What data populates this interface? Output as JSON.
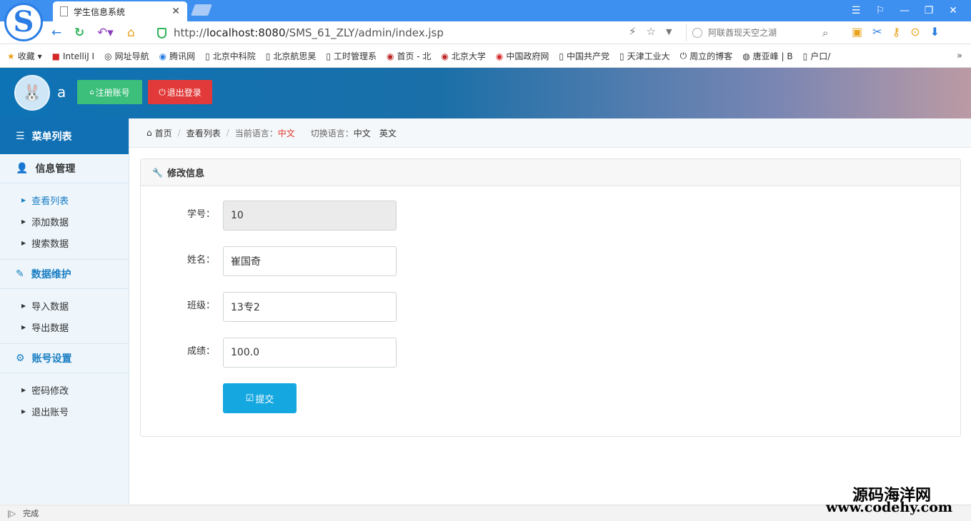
{
  "browser": {
    "tab_title": "学生信息系统",
    "url_prefix": "http://",
    "url_host": "localhost:8080",
    "url_path": "/SMS_61_ZLY/admin/index.jsp",
    "search_placeholder": "阿联酋现天空之湖",
    "window_controls": [
      "☰",
      "⚐",
      "—",
      "❐",
      "✕"
    ]
  },
  "bookmarks": [
    {
      "icon": "★",
      "label": "收藏 ▾"
    },
    {
      "icon": "■",
      "label": "IntelliJ I"
    },
    {
      "icon": "◎",
      "label": "网址导航"
    },
    {
      "icon": "◉",
      "label": "腾讯网"
    },
    {
      "icon": "▯",
      "label": "北京中科院"
    },
    {
      "icon": "▯",
      "label": "北京航思昊"
    },
    {
      "icon": "▯",
      "label": "工时管理系"
    },
    {
      "icon": "◉",
      "label": "首页 - 北"
    },
    {
      "icon": "◉",
      "label": "北京大学"
    },
    {
      "icon": "◉",
      "label": "中国政府网"
    },
    {
      "icon": "▯",
      "label": "中国共产党"
    },
    {
      "icon": "▯",
      "label": "天津工业大"
    },
    {
      "icon": "⏻",
      "label": "周立的博客"
    },
    {
      "icon": "◍",
      "label": "唐亚峰 | B"
    },
    {
      "icon": "▯",
      "label": "户口/"
    }
  ],
  "header": {
    "username": "a",
    "register_label": "注册账号",
    "logout_label": "退出登录"
  },
  "sidebar": {
    "title": "菜单列表",
    "groups": [
      {
        "title": "信息管理",
        "items": [
          "查看列表",
          "添加数据",
          "搜索数据"
        ]
      },
      {
        "title": "数据维护",
        "items": [
          "导入数据",
          "导出数据"
        ]
      },
      {
        "title": "账号设置",
        "items": [
          "密码修改",
          "退出账号"
        ]
      }
    ]
  },
  "breadcrumb": {
    "home": "首页",
    "current": "查看列表",
    "lang_label": "当前语言：",
    "lang_value": "中文",
    "switch_label": "切换语言：",
    "switch_zh": "中文",
    "switch_en": "英文"
  },
  "form": {
    "title": "修改信息",
    "fields": [
      {
        "label": "学号：",
        "value": "10"
      },
      {
        "label": "姓名：",
        "value": "崔国奇"
      },
      {
        "label": "班级：",
        "value": "13专2"
      },
      {
        "label": "成绩：",
        "value": "100.0"
      }
    ],
    "submit_label": "提交"
  },
  "status": {
    "text": "完成"
  },
  "watermark": {
    "line1": "源码海洋网",
    "line2": "www.codehy.com"
  }
}
